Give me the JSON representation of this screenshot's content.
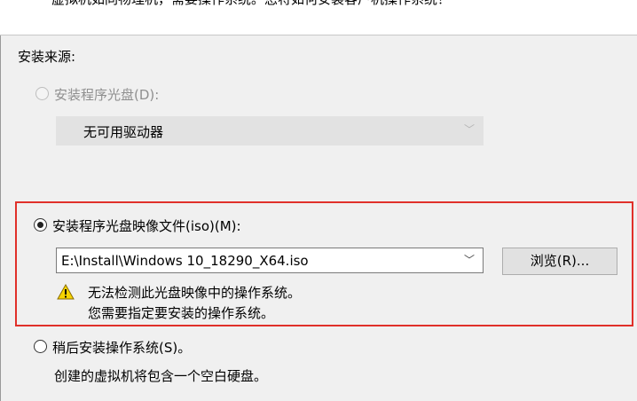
{
  "header": {
    "description": "虚拟机如同物理机，需要操作系统。您将如何安装客户机操作系统？"
  },
  "install_source": {
    "label": "安装来源:",
    "option_disc": {
      "label": "安装程序光盘(D):",
      "selected": false,
      "enabled": false,
      "drive_value": "无可用驱动器"
    },
    "option_iso": {
      "label": "安装程序光盘映像文件(iso)(M):",
      "selected": true,
      "path_value": "E:\\Install\\Windows 10_18290_X64.iso",
      "browse_label": "浏览(R)...",
      "warning_line1": "无法检测此光盘映像中的操作系统。",
      "warning_line2": "您需要指定要安装的操作系统。"
    },
    "option_later": {
      "label": "稍后安装操作系统(S)。",
      "selected": false,
      "description": "创建的虚拟机将包含一个空白硬盘。"
    }
  },
  "colors": {
    "highlight_border": "#e0302a",
    "warning_yellow": "#f7d400",
    "dialog_bg": "#f0f0f0"
  }
}
